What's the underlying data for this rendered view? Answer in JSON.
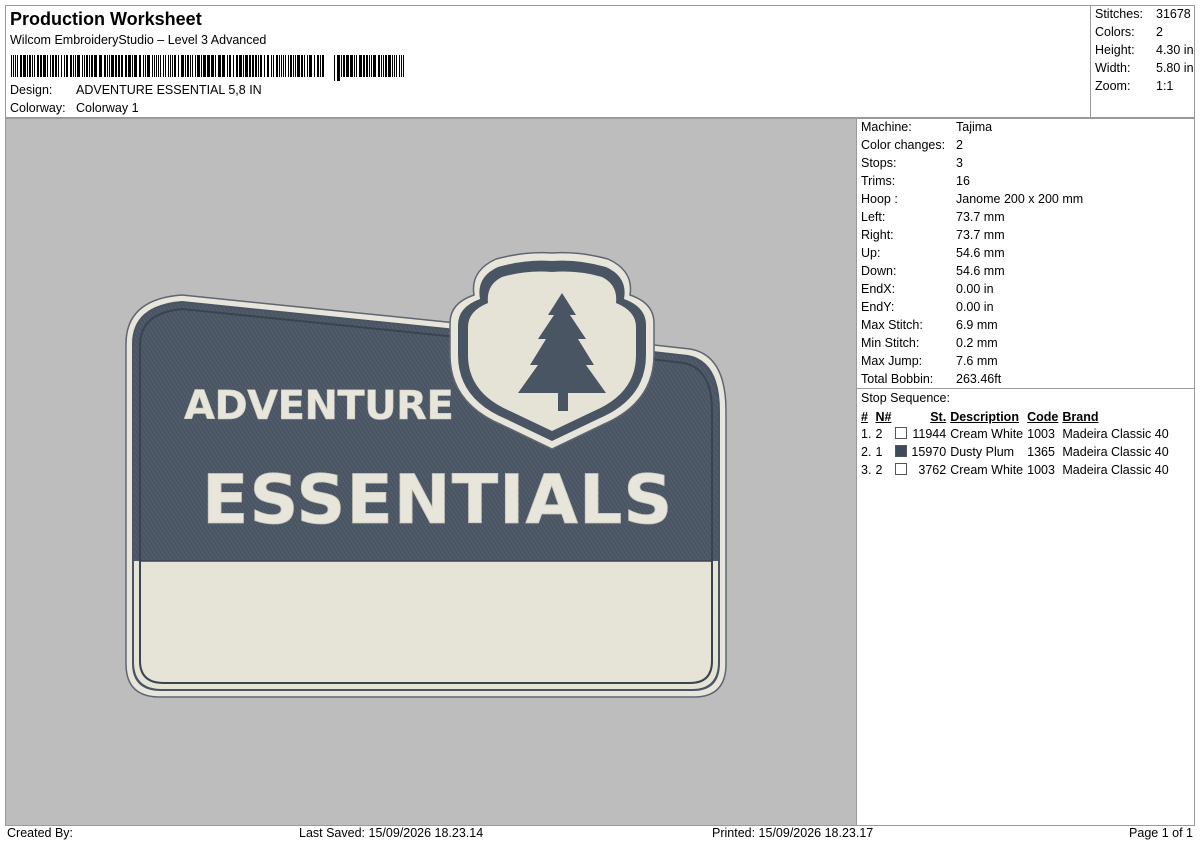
{
  "header": {
    "title": "Production Worksheet",
    "software": "Wilcom EmbroideryStudio – Level 3 Advanced",
    "design_label": "Design:",
    "design_value": "ADVENTURE ESSENTIAL 5,8 IN",
    "colorway_label": "Colorway:",
    "colorway_value": "Colorway 1"
  },
  "stats": [
    {
      "label": "Stitches:",
      "value": "31678"
    },
    {
      "label": "Colors:",
      "value": "2"
    },
    {
      "label": "Height:",
      "value": "4.30 in"
    },
    {
      "label": "Width:",
      "value": "5.80 in"
    },
    {
      "label": "Zoom:",
      "value": "1:1"
    }
  ],
  "machine": [
    {
      "label": "Machine:",
      "value": "Tajima"
    },
    {
      "label": "Color changes:",
      "value": "2"
    },
    {
      "label": "Stops:",
      "value": "3"
    },
    {
      "label": "Trims:",
      "value": "16"
    },
    {
      "label": "Hoop :",
      "value": "Janome 200 x 200 mm"
    },
    {
      "label": "Left:",
      "value": "73.7 mm"
    },
    {
      "label": "Right:",
      "value": "73.7 mm"
    },
    {
      "label": "Up:",
      "value": "54.6 mm"
    },
    {
      "label": "Down:",
      "value": "54.6 mm"
    },
    {
      "label": "EndX:",
      "value": "0.00 in"
    },
    {
      "label": "EndY:",
      "value": "0.00 in"
    },
    {
      "label": "Max Stitch:",
      "value": "6.9 mm"
    },
    {
      "label": "Min Stitch:",
      "value": "0.2 mm"
    },
    {
      "label": "Max Jump:",
      "value": "7.6 mm"
    },
    {
      "label": "Total Bobbin:",
      "value": "263.46ft"
    }
  ],
  "stop_sequence": {
    "title": "Stop Sequence:",
    "headers": {
      "num": "#",
      "n": "N#",
      "st": "St.",
      "description": "Description",
      "code": "Code",
      "brand": "Brand"
    },
    "rows": [
      {
        "num": "1.",
        "n": "2",
        "color": "#ffffff",
        "st": "11944",
        "description": "Cream White",
        "code": "1003",
        "brand": "Madeira Classic 40"
      },
      {
        "num": "2.",
        "n": "1",
        "color": "#3d4a5c",
        "st": "15970",
        "description": "Dusty Plum",
        "code": "1365",
        "brand": "Madeira Classic 40"
      },
      {
        "num": "3.",
        "n": "2",
        "color": "#ffffff",
        "st": "3762",
        "description": "Cream White",
        "code": "1003",
        "brand": "Madeira Classic 40"
      }
    ]
  },
  "design": {
    "line1": "ADVENTURE",
    "line2": "ESSENTIALS",
    "fill_color": "#4a5564",
    "cream_color": "#e8e6da",
    "background": "#bdbdbd"
  },
  "footer": {
    "created_by": "Created By:",
    "last_saved": "Last Saved: 15/09/2026 18.23.14",
    "printed": "Printed: 15/09/2026 18.23.17",
    "page": "Page 1 of 1"
  }
}
